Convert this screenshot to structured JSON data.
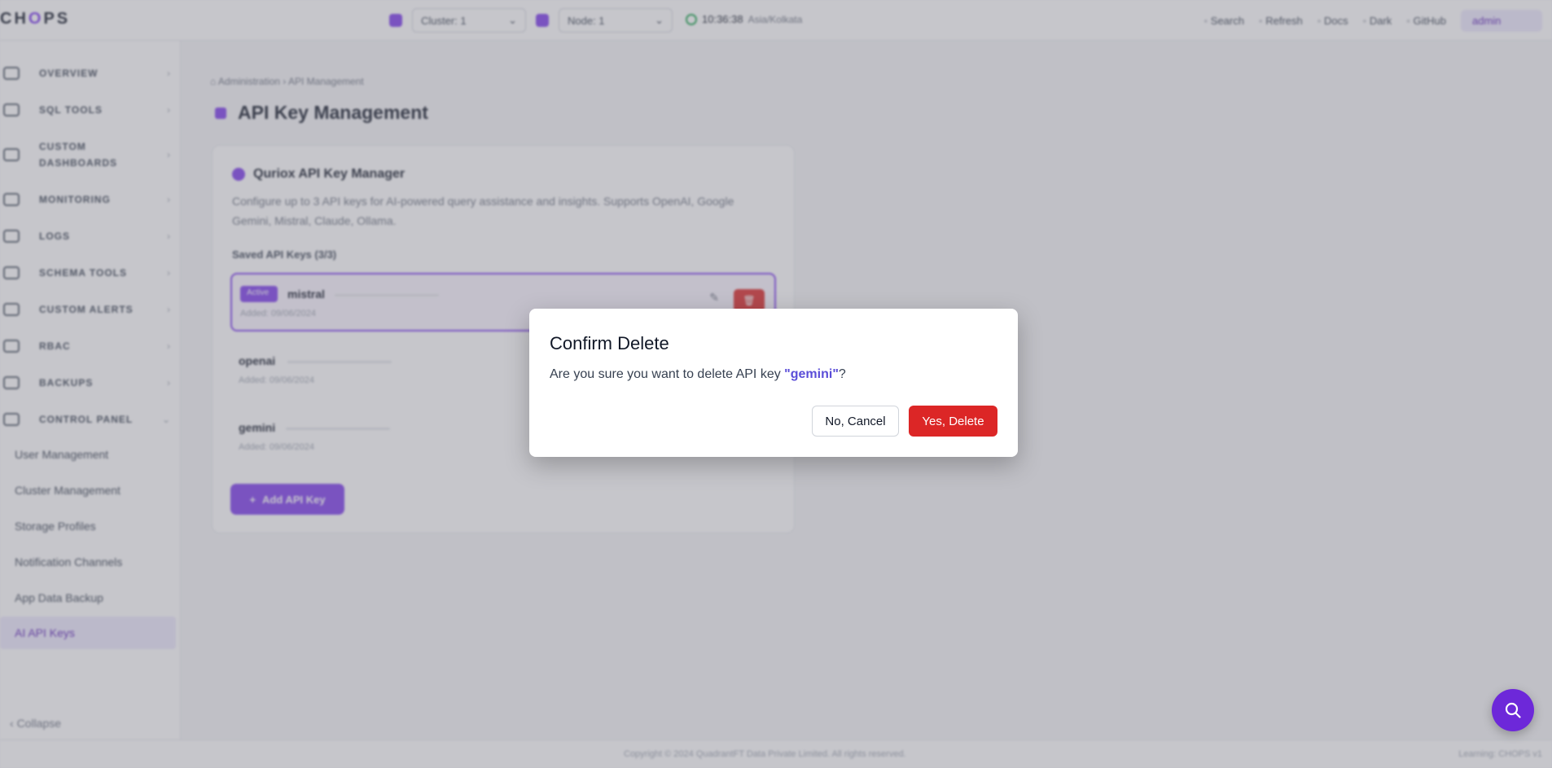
{
  "topbar": {
    "logo": "CHOPS",
    "cluster_select": "Cluster: 1",
    "node_select": "Node: 1",
    "time": "10:36:38",
    "timezone": "Asia/Kolkata",
    "actions": [
      "Search",
      "Refresh",
      "Docs",
      "Dark",
      "GitHub"
    ],
    "user": "admin"
  },
  "sidebar": {
    "items": [
      {
        "label": "OVERVIEW"
      },
      {
        "label": "SQL TOOLS"
      },
      {
        "label": "CUSTOM DASHBOARDS"
      },
      {
        "label": "MONITORING"
      },
      {
        "label": "LOGS"
      },
      {
        "label": "SCHEMA TOOLS"
      },
      {
        "label": "CUSTOM ALERTS"
      },
      {
        "label": "RBAC"
      },
      {
        "label": "BACKUPS"
      },
      {
        "label": "CONTROL PANEL"
      }
    ],
    "sub_items": [
      "User Management",
      "Cluster Management",
      "Storage Profiles",
      "Notification Channels",
      "App Data Backup"
    ],
    "active_sub_item": "AI API Keys",
    "collapse_label": "Collapse"
  },
  "breadcrumb": {
    "parent": "Administration",
    "current": "API Management"
  },
  "page": {
    "title": "API Key Management"
  },
  "card": {
    "title": "Quriox API Key Manager",
    "description": "Configure up to 3 API keys for AI-powered query assistance and insights. Supports OpenAI, Google Gemini, Mistral, Claude, Ollama.",
    "saved_label": "Saved API Keys (3/3)",
    "keys": [
      {
        "badge": "Active",
        "name": "mistral",
        "date": "Added: 09/06/2024"
      },
      {
        "badge": "",
        "name": "openai",
        "date": "Added: 09/06/2024"
      },
      {
        "badge": "",
        "name": "gemini",
        "date": "Added: 09/06/2024"
      }
    ],
    "add_button": "Add API Key"
  },
  "footer": {
    "copyright": "Copyright © 2024 QuadrantFT Data Private Limited. All rights reserved.",
    "version": "Learning: CHOPS v1"
  },
  "modal": {
    "title": "Confirm Delete",
    "message_prefix": "Are you sure you want to delete API key ",
    "key_name": "\"gemini\"",
    "message_suffix": "?",
    "cancel_label": "No, Cancel",
    "confirm_label": "Yes, Delete"
  },
  "colors": {
    "accent": "#7c3aed",
    "danger": "#dc2626",
    "keyword": "#5b4ed8"
  },
  "icons": {
    "fab": "search-icon"
  }
}
